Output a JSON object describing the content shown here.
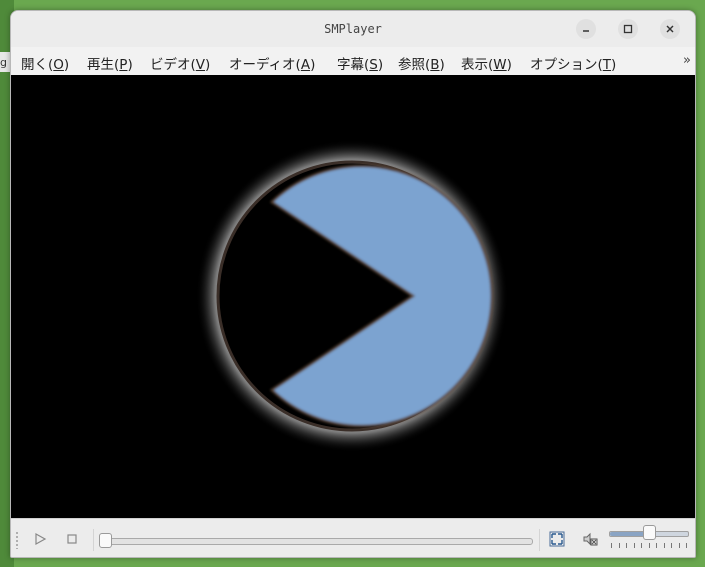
{
  "window": {
    "title": "SMPlayer"
  },
  "background": {
    "partial_text": "g"
  },
  "menubar": {
    "items": [
      {
        "text": "開く(",
        "key": "O",
        "close": ")"
      },
      {
        "text": "再生(",
        "key": "P",
        "close": ")"
      },
      {
        "text": "ビデオ(",
        "key": "V",
        "close": ")"
      },
      {
        "text": "オーディオ(",
        "key": "A",
        "close": ")"
      },
      {
        "text": "字幕(",
        "key": "S",
        "close": ")"
      },
      {
        "text": "参照(",
        "key": "B",
        "close": ")"
      },
      {
        "text": "表示(",
        "key": "W",
        "close": ")"
      },
      {
        "text": "オプション(",
        "key": "T",
        "close": ")"
      }
    ],
    "overflow": "»"
  },
  "controls": {
    "seek_position": 0,
    "volume_level": 0.55
  },
  "colors": {
    "logo_blue": "#7ba3d0",
    "video_bg": "#000000"
  },
  "icons": [
    "minimize-icon",
    "maximize-icon",
    "close-icon",
    "play-icon",
    "stop-icon",
    "fullscreen-icon",
    "mute-icon"
  ]
}
